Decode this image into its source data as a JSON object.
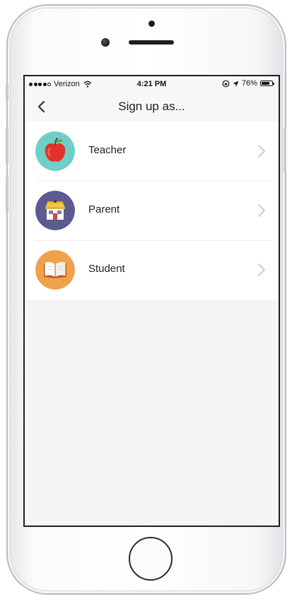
{
  "status_bar": {
    "carrier": "Verizon",
    "time": "4:21 PM",
    "battery_percent": "76%",
    "battery_level": 0.76
  },
  "nav": {
    "title": "Sign up as..."
  },
  "options": [
    {
      "label": "Teacher",
      "icon": "apple-icon",
      "color": "#6fcfc8"
    },
    {
      "label": "Parent",
      "icon": "house-icon",
      "color": "#5b5a92"
    },
    {
      "label": "Student",
      "icon": "book-icon",
      "color": "#f0a24a"
    }
  ],
  "colors": {
    "screen_background": "#f5f5f4",
    "list_background": "#ffffff",
    "chevron": "#c7c7cc"
  }
}
